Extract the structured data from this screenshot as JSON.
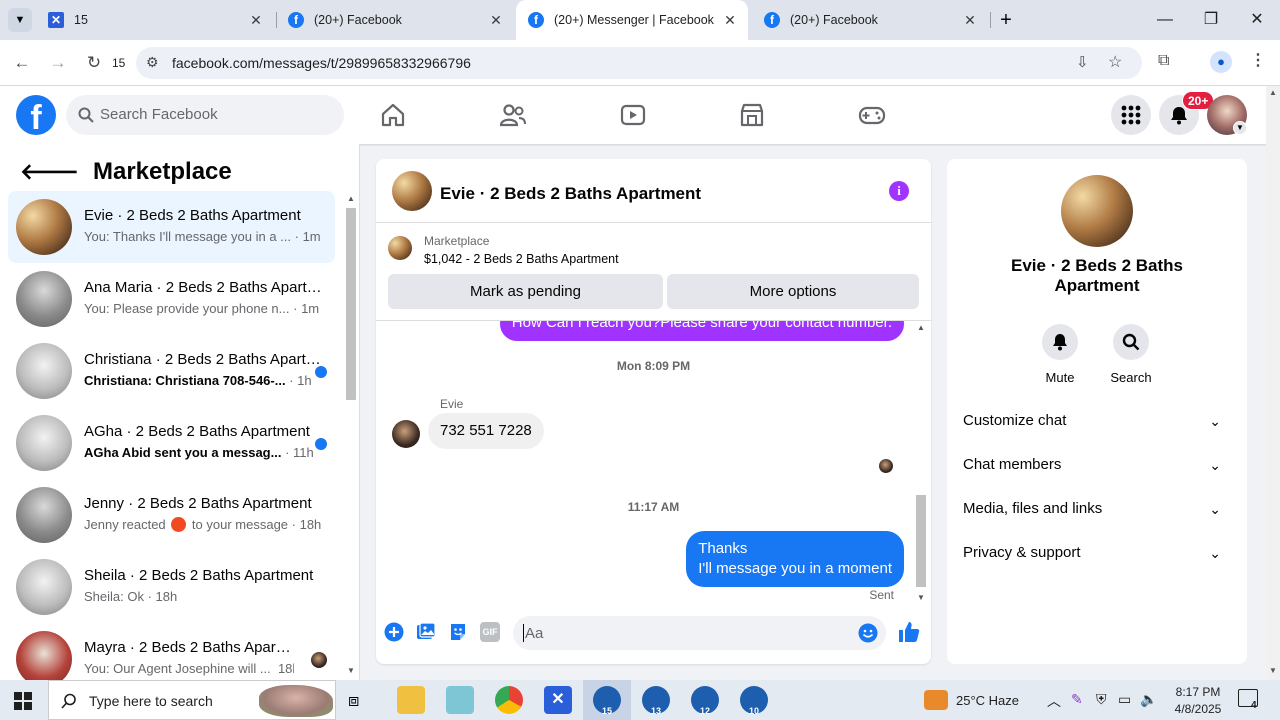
{
  "browser": {
    "tabs": [
      {
        "title": "15",
        "icon": "jira-icon"
      },
      {
        "title": "(20+) Facebook",
        "icon": "facebook-icon"
      },
      {
        "title": "(20+) Messenger | Facebook",
        "icon": "facebook-icon",
        "active": true
      },
      {
        "title": "(20+) Facebook",
        "icon": "facebook-icon"
      }
    ],
    "reload_badge": "15",
    "url": "facebook.com/messages/t/29899658332966796"
  },
  "fb": {
    "search_placeholder": "Search Facebook",
    "notif_count": "20+"
  },
  "left": {
    "title": "Marketplace",
    "conversations": [
      {
        "name": "Evie · 2 Beds 2 Baths Apartment",
        "preview": "You: Thanks I'll message you in a ...",
        "time": "· 1m",
        "selected": true,
        "unread": false
      },
      {
        "name": "Ana Maria · 2 Beds 2 Baths Apartment",
        "preview": "You: Please provide your phone n...",
        "time": "· 1m",
        "unread": false
      },
      {
        "name": "Christiana · 2 Beds 2 Baths Apartment",
        "preview": "Christiana: Christiana 708-546-...",
        "time": "· 1h",
        "unread": true
      },
      {
        "name": "AGha · 2 Beds 2 Baths Apartment",
        "preview": "AGha Abid sent you a messag...",
        "time": "· 11h",
        "unread": true
      },
      {
        "name": "Jenny · 2 Beds 2 Baths Apartment",
        "preview": "Jenny reacted",
        "preview_suffix": "to your message",
        "time": "· 18h",
        "unread": false
      },
      {
        "name": "Sheila · 2 Beds 2 Baths Apartment",
        "preview": "Sheila: Ok",
        "time": "· 18h",
        "unread": false
      },
      {
        "name": "Mayra · 2 Beds 2 Baths Apartment",
        "preview": "You: Our Agent Josephine will ...",
        "time": "18h",
        "unread": false
      }
    ]
  },
  "chat": {
    "name": "Evie · 2 Beds 2 Baths Apartment",
    "marketplace_label": "Marketplace",
    "listing": "$1,042 - 2 Beds 2 Baths Apartment",
    "btn_pending": "Mark as pending",
    "btn_more": "More options",
    "prev_message": "How Can I reach you?Please share your contact number.",
    "stamp1": "Mon 8:09 PM",
    "sender": "Evie",
    "incoming": "732 551 7228",
    "stamp2": "11:17 AM",
    "out_line1": "Thanks",
    "out_line2": "I'll message you in a moment",
    "status": "Sent",
    "composer_placeholder": "Aa"
  },
  "right": {
    "name": "Evie · 2 Beds 2 Baths Apartment",
    "mute": "Mute",
    "search": "Search",
    "sections": [
      "Customize chat",
      "Chat members",
      "Media, files and links",
      "Privacy & support"
    ]
  },
  "taskbar": {
    "search_placeholder": "Type here to search",
    "weather": "25°C  Haze",
    "time": "8:17 PM",
    "date": "4/8/2025",
    "notif": "4",
    "app_badges": [
      "15",
      "13",
      "12",
      "10"
    ]
  },
  "colors": {
    "fb_blue": "#1877f2",
    "messenger_purple": "#a033ff",
    "unread_blue": "#1877f2"
  }
}
